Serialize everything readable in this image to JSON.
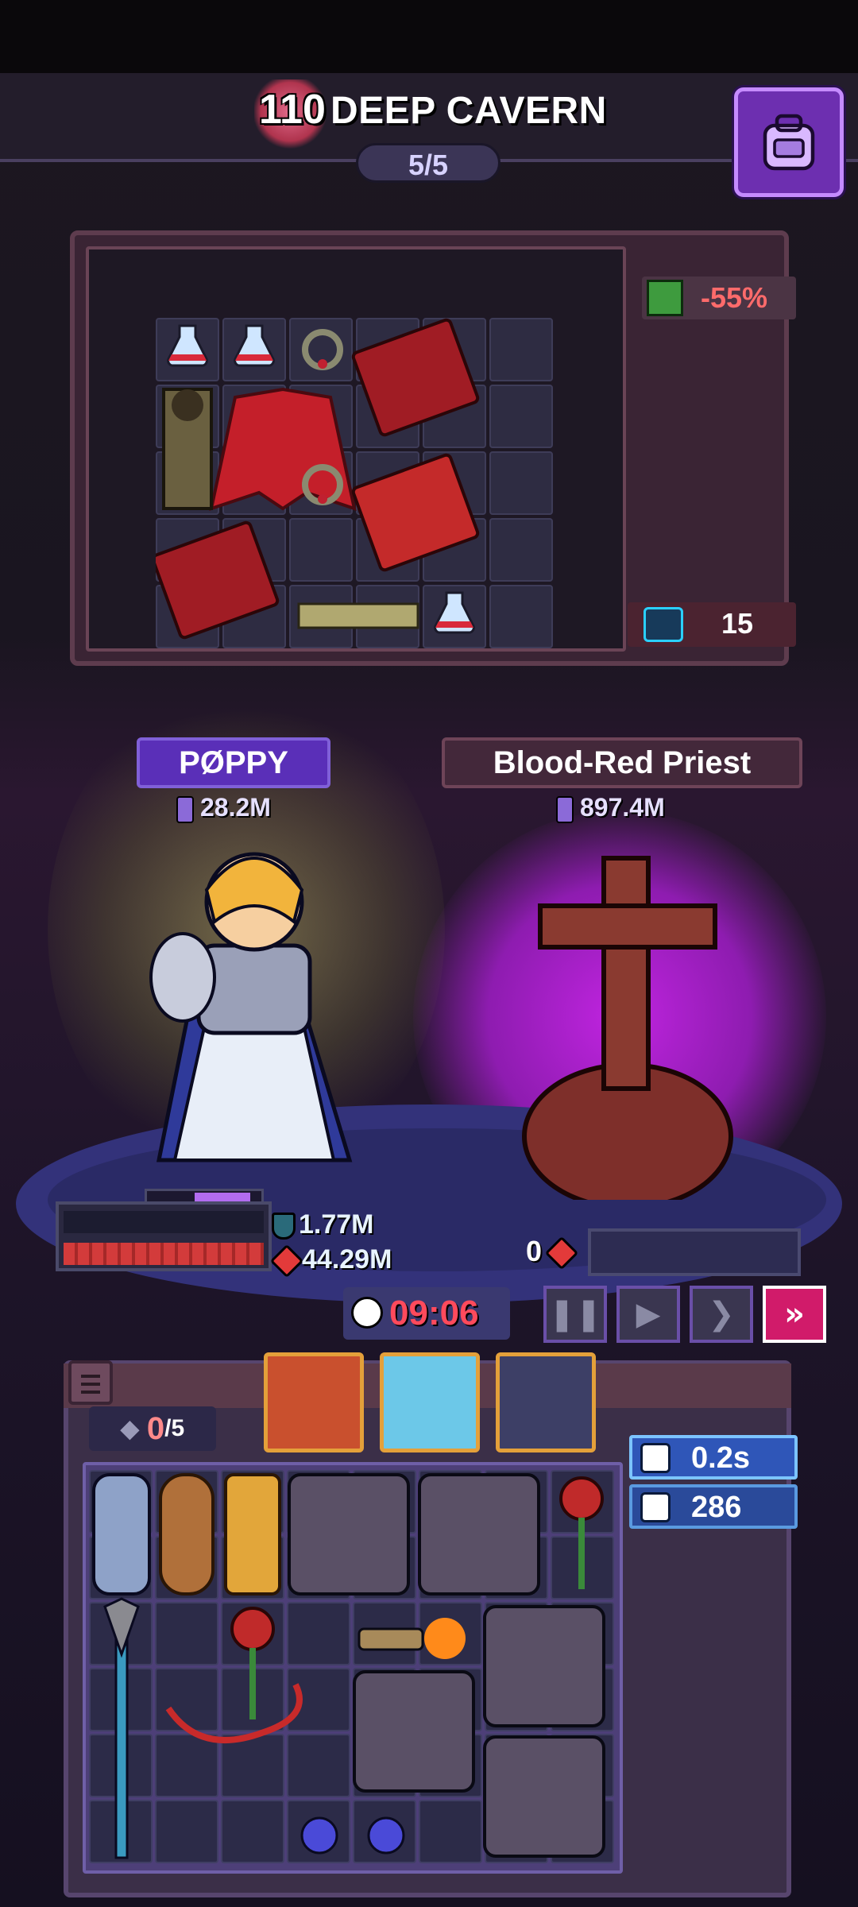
{
  "header": {
    "stage_number": "110",
    "stage_name": "DEEP CAVERN",
    "wave": "5/5",
    "bag_button_icon": "backpack-icon"
  },
  "enemy_panel": {
    "debuff_value": "-55%",
    "debuff_icon": "regen-down-icon",
    "item_count": "15",
    "item_count_icon": "gear-icon"
  },
  "hero": {
    "name": "PØPPY",
    "power": "28.2M",
    "shield": "1.77M",
    "health": "44.29M",
    "health_fraction": 1.0
  },
  "enemy": {
    "name": "Blood-Red Priest",
    "power": "897.4M",
    "health": "0"
  },
  "battle": {
    "timer": "09:06",
    "controls": [
      "pause-button",
      "play-button",
      "speed-2x-button",
      "speed-3x-button"
    ],
    "active_control": "speed-3x-button"
  },
  "player_bag": {
    "slots_used": "0",
    "slots_total": "/5",
    "cooldown": "0.2s",
    "item_count": "286"
  },
  "colors": {
    "accent_purple": "#6d2fb0",
    "enemy_glow": "#c024e0",
    "timer_red": "#ff4a5c",
    "active_speed": "#d11b6a"
  }
}
